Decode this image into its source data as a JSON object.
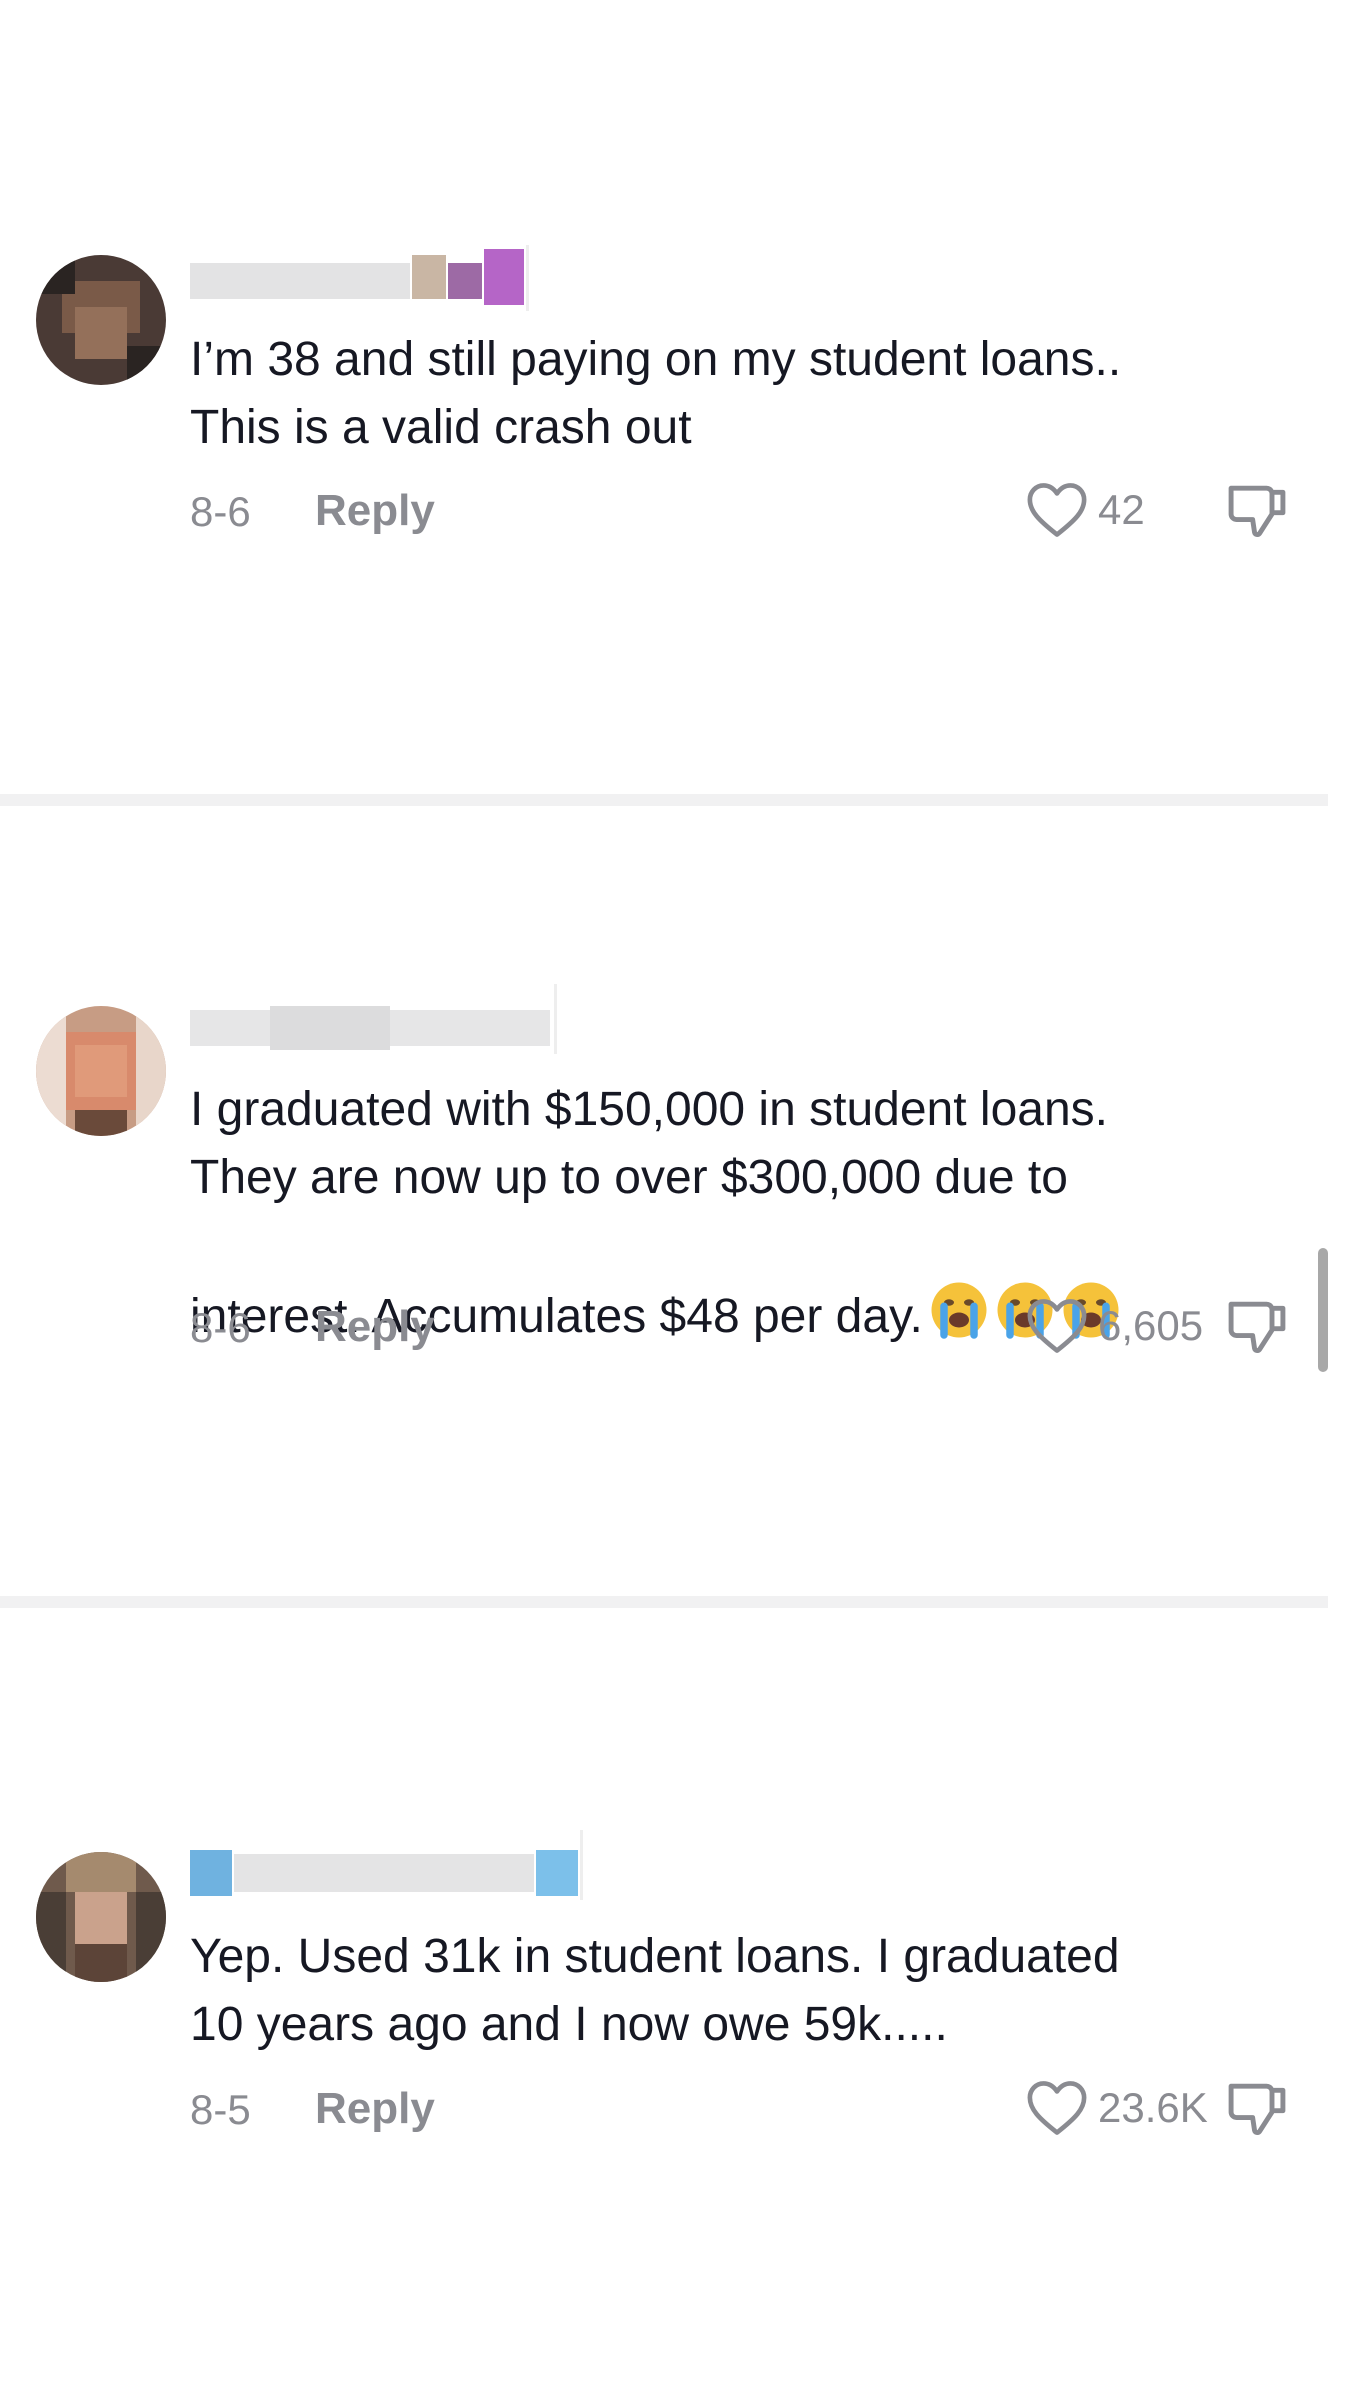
{
  "comments": [
    {
      "text": "I’m 38 and still paying on my student loans..\nThis is a valid crash out",
      "date": "8-6",
      "reply_label": "Reply",
      "likes": "42",
      "emojis": []
    },
    {
      "text": "I graduated with $150,000 in student loans.\nThey are now up to over $300,000 due to\ninterest. Accumulates $48 per day.",
      "date": "8-6",
      "reply_label": "Reply",
      "likes": "6,605",
      "emojis": [
        "loudly-crying-face",
        "loudly-crying-face",
        "loudly-crying-face"
      ]
    },
    {
      "text": "Yep. Used 31k in student loans. I graduated\n10 years ago and I now owe 59k.....",
      "date": "8-5",
      "reply_label": "Reply",
      "likes": "23.6K",
      "emojis": []
    }
  ],
  "icons": {
    "like": "heart-outline-icon",
    "dislike": "thumbs-down-icon",
    "avatar": "pixelated-avatar",
    "username": "pixelated-username"
  },
  "colors": {
    "text": "#161823",
    "secondary": "#8a8b91",
    "divider": "#f1f1f2",
    "background": "#ffffff"
  }
}
